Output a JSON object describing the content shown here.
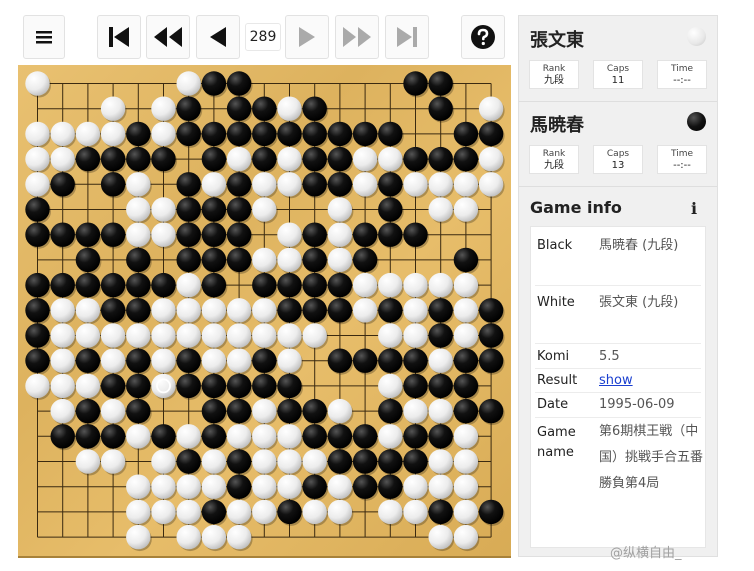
{
  "toolbar": {
    "move_number": "289",
    "buttons": [
      {
        "name": "menu-icon"
      },
      {
        "name": "first-move-icon"
      },
      {
        "name": "rewind-icon"
      },
      {
        "name": "previous-move-icon"
      },
      {
        "name": "next-move-icon"
      },
      {
        "name": "fast-forward-icon"
      },
      {
        "name": "last-move-icon"
      },
      {
        "name": "help-icon"
      }
    ]
  },
  "players": [
    {
      "name": "張文東",
      "color": "white",
      "rank_label": "Rank",
      "rank": "九段",
      "caps_label": "Caps",
      "caps": "11",
      "time_label": "Time",
      "time": "--:--"
    },
    {
      "name": "馬暁春",
      "color": "black",
      "rank_label": "Rank",
      "rank": "九段",
      "caps_label": "Caps",
      "caps": "13",
      "time_label": "Time",
      "time": "--:--"
    }
  ],
  "game_info": {
    "title": "Game info",
    "icon": "info-icon",
    "black_label": "Black",
    "black": "馬暁春 (九段)",
    "white_label": "White",
    "white": "張文東 (九段)",
    "komi_label": "Komi",
    "komi": "5.5",
    "result_label": "Result",
    "result_link": "show",
    "date_label": "Date",
    "date": "1995-06-09",
    "game_name_label": "Game name",
    "game_name": "第6期棋王戦（中国）挑戦手合五番勝負第4局"
  },
  "board": {
    "size": 19,
    "last_move": [
      5,
      12
    ],
    "rows": [
      "W.....WBB......BB..",
      "...W.WB.BBWB....B.W",
      "WWWWBWBBBBBBBBB..BB",
      "WWBBBB.BWBWBBWWBBBW",
      "WB.BW.BWBWWBBWBWWWW",
      "B...WWBBBW..W.B.WW.",
      "BBBBWWBBB.WBWBBB...",
      "..B.B.BBBWWBWB...B.",
      "BBBBBBWB.BBBBWWWWW.",
      "BWWBBWWWWWBBBWBWBWB",
      "BWWWWWWWWWWW..WWBWB",
      "BWBWBWBWWBW.BBBBWBB",
      "WWWBBWBBBBB...WBBB.",
      ".WBWB..BBWBBW.BWWBB",
      ".BBBWBWBWWWBBBWBBW.",
      "..WW.WBWBWWWBBBBWW.",
      "....WWWWBWWBWBBWWW.",
      "....WWWBWWBWW.WWBWB",
      "....W.WWW.......WW."
    ]
  },
  "watermark": "@纵横自由_"
}
